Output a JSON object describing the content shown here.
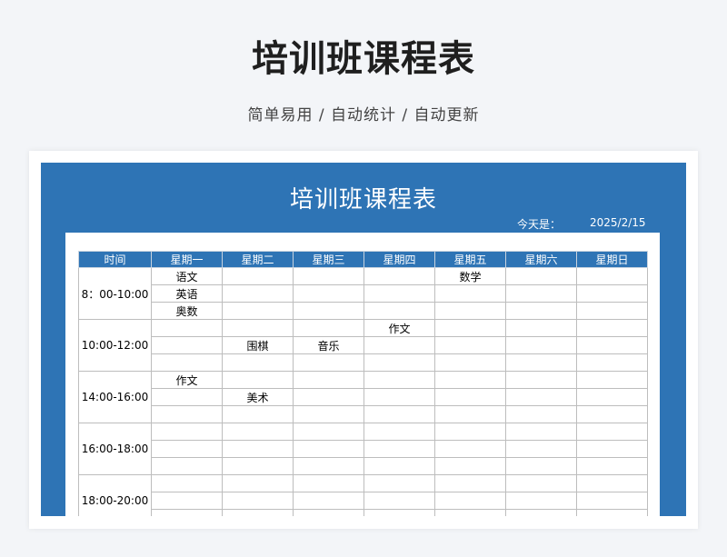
{
  "header": {
    "title": "培训班课程表",
    "subtitle": "简单易用 / 自动统计 / 自动更新"
  },
  "sheet": {
    "title": "培训班课程表",
    "date_label": "今天是：",
    "date_value": "2025/2/15"
  },
  "table": {
    "columns": [
      "时间",
      "星期一",
      "星期二",
      "星期三",
      "星期四",
      "星期五",
      "星期六",
      "星期日"
    ],
    "blocks": [
      {
        "time": "8：00-10:00",
        "rows": [
          [
            "语文",
            "",
            "",
            "",
            "数学",
            "",
            ""
          ],
          [
            "英语",
            "",
            "",
            "",
            "",
            "",
            ""
          ],
          [
            "奥数",
            "",
            "",
            "",
            "",
            "",
            ""
          ]
        ]
      },
      {
        "time": "10:00-12:00",
        "rows": [
          [
            "",
            "",
            "",
            "作文",
            "",
            "",
            ""
          ],
          [
            "",
            "围棋",
            "音乐",
            "",
            "",
            "",
            ""
          ],
          [
            "",
            "",
            "",
            "",
            "",
            "",
            ""
          ]
        ]
      },
      {
        "time": "14:00-16:00",
        "rows": [
          [
            "作文",
            "",
            "",
            "",
            "",
            "",
            ""
          ],
          [
            "",
            "美术",
            "",
            "",
            "",
            "",
            ""
          ],
          [
            "",
            "",
            "",
            "",
            "",
            "",
            ""
          ]
        ]
      },
      {
        "time": "16:00-18:00",
        "rows": [
          [
            "",
            "",
            "",
            "",
            "",
            "",
            ""
          ],
          [
            "",
            "",
            "",
            "",
            "",
            "",
            ""
          ],
          [
            "",
            "",
            "",
            "",
            "",
            "",
            ""
          ]
        ]
      },
      {
        "time": "18:00-20:00",
        "rows": [
          [
            "",
            "",
            "",
            "",
            "",
            "",
            ""
          ],
          [
            "",
            "",
            "",
            "",
            "",
            "",
            ""
          ],
          [
            "",
            "",
            "",
            "",
            "",
            "",
            ""
          ]
        ]
      }
    ]
  }
}
